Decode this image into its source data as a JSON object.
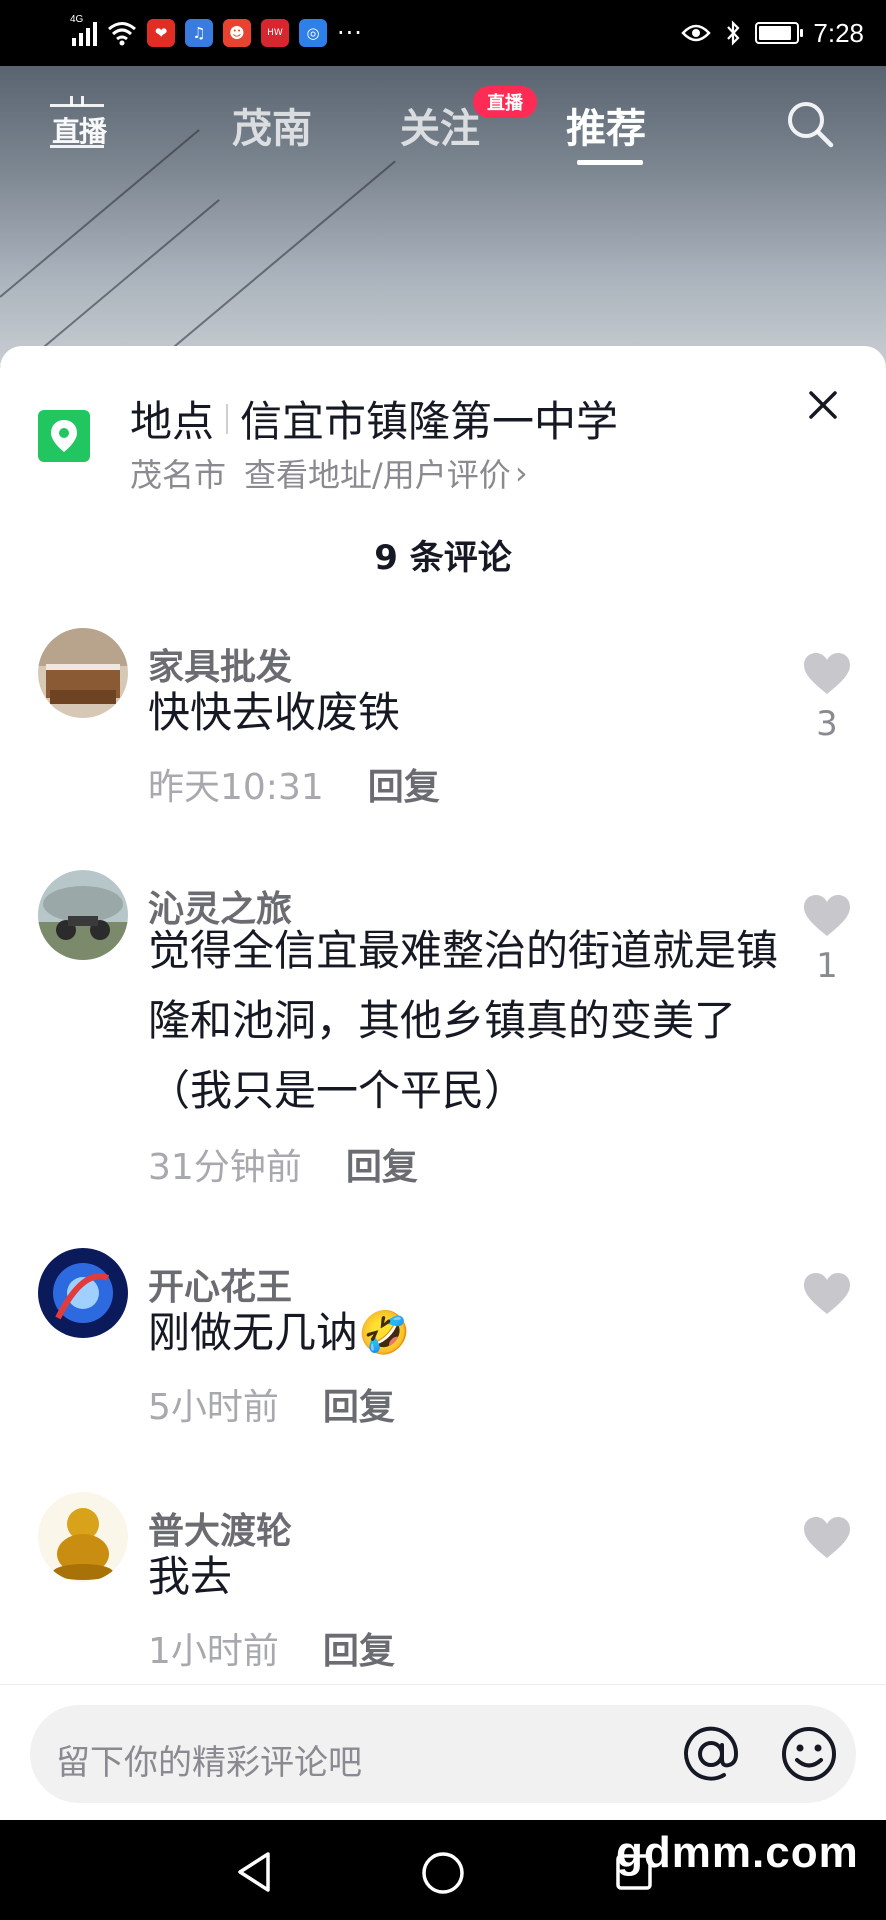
{
  "status_bar": {
    "network": "4G",
    "time": "7:28",
    "more": "···"
  },
  "top_nav": {
    "live_label": "直播",
    "tabs": [
      "茂南",
      "关注",
      "推荐"
    ],
    "active_tab": "推荐",
    "live_badge": "直播"
  },
  "location": {
    "prefix": "地点",
    "name": "信宜市镇隆第一中学",
    "city": "茂名市",
    "link": "查看地址/用户评价",
    "link_chevron": "›"
  },
  "comment_count": "9 条评论",
  "comments": [
    {
      "user": "家具批发",
      "text": "快快去收废铁",
      "time": "昨天10:31",
      "reply": "回复",
      "likes": "3"
    },
    {
      "user": "沁灵之旅",
      "text": "觉得全信宜最难整治的街道就是镇隆和池洞，其他乡镇真的变美了（我只是一个平民）",
      "time": "31分钟前",
      "reply": "回复",
      "likes": "1"
    },
    {
      "user": "开心花王",
      "text": "刚做无几讷",
      "emoji": "🤣",
      "time": "5小时前",
      "reply": "回复",
      "likes": ""
    },
    {
      "user": "普大渡轮",
      "text": "我去",
      "time": "1小时前",
      "reply": "回复",
      "likes": ""
    }
  ],
  "input": {
    "placeholder": "留下你的精彩评论吧"
  },
  "watermark": "gdmm.com",
  "colors": {
    "accent": "#fe2c55",
    "location_green": "#22c660",
    "text_primary": "#161823",
    "text_secondary": "#8a8b91"
  }
}
